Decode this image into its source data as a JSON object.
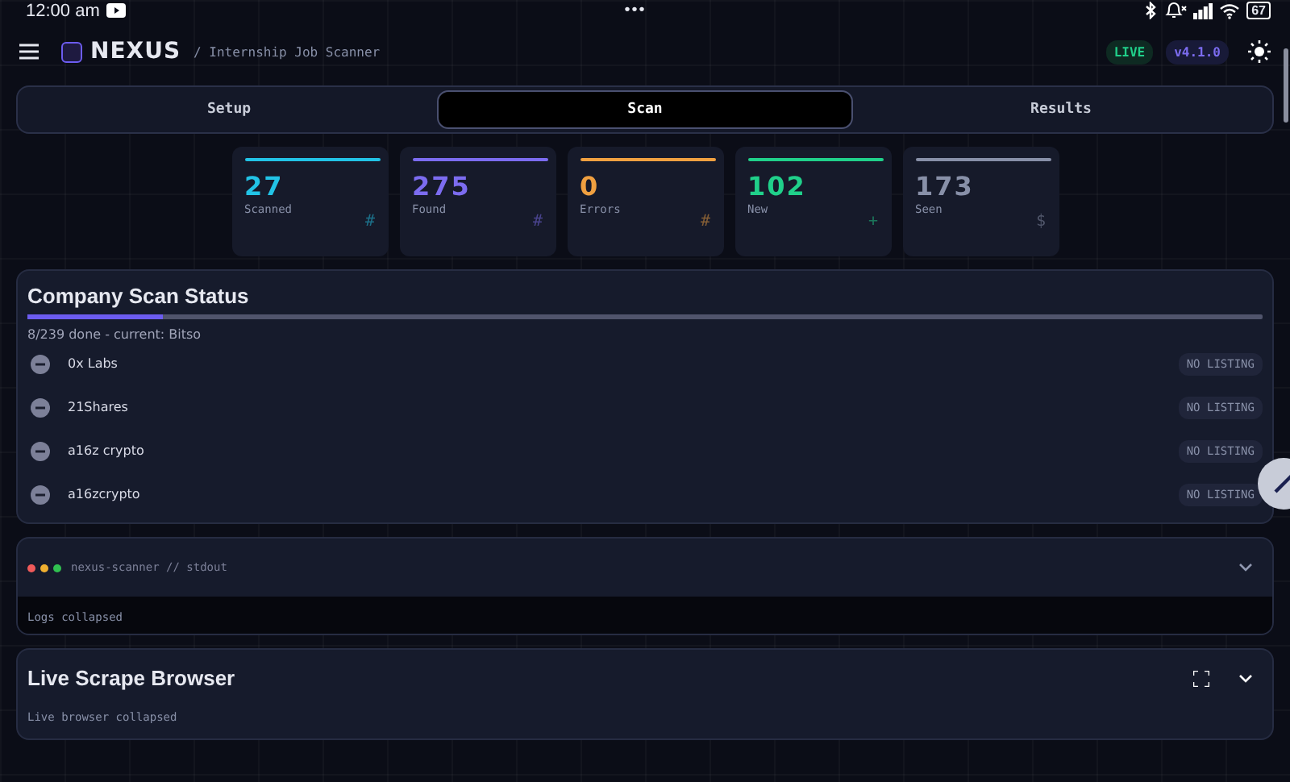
{
  "status_bar": {
    "time": "12:00 am",
    "dots": "•••",
    "battery": "67"
  },
  "header": {
    "logo": "NEXUS",
    "subtitle": "/ Internship Job Scanner",
    "live_badge": "LIVE",
    "version_badge": "v4.1.0"
  },
  "tabs": [
    {
      "label": "Setup",
      "selected": false
    },
    {
      "label": "Scan",
      "selected": true
    },
    {
      "label": "Results",
      "selected": false
    }
  ],
  "stats": [
    {
      "value": "27",
      "label": "Scanned",
      "symbol": "#",
      "color": "#22c3e6"
    },
    {
      "value": "275",
      "label": "Found",
      "symbol": "#",
      "color": "#7c6cf0"
    },
    {
      "value": "0",
      "label": "Errors",
      "symbol": "#",
      "color": "#f0a040"
    },
    {
      "value": "102",
      "label": "New",
      "symbol": "+",
      "color": "#20d08a"
    },
    {
      "value": "173",
      "label": "Seen",
      "symbol": "$",
      "color": "#8890a8"
    }
  ],
  "company_scan": {
    "title": "Company Scan Status",
    "progress": {
      "level": 0.11
    },
    "summary": "8/239 done - current: Bitso",
    "companies": [
      {
        "name": "0x Labs",
        "kind": "none",
        "badge": "NO LISTING"
      },
      {
        "name": "21Shares",
        "kind": "none",
        "badge": "NO LISTING"
      },
      {
        "name": "a16z crypto",
        "kind": "none",
        "badge": "NO LISTING"
      },
      {
        "name": "a16zcrypto",
        "kind": "none",
        "badge": "NO LISTING"
      }
    ]
  },
  "logs": {
    "title": "nexus-scanner // stdout",
    "expanded": false,
    "note": "Logs collapsed"
  },
  "browser": {
    "title": "Live Scrape Browser",
    "expanded": false,
    "note": "Live browser collapsed"
  }
}
